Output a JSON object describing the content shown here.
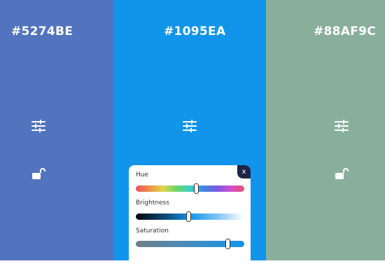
{
  "palette": {
    "columns": [
      {
        "hex": "#5274BE",
        "color": "#5274be"
      },
      {
        "hex": "#1095EA",
        "color": "#1095ea"
      },
      {
        "hex": "#88AF9C",
        "color": "#88af9c"
      }
    ]
  },
  "icons": {
    "adjust": "sliders-icon",
    "lock": "unlocked-padlock-icon"
  },
  "panel": {
    "close_label": "x",
    "sliders": [
      {
        "label": "Hue",
        "value": 0.56
      },
      {
        "label": "Brightness",
        "value": 0.49
      },
      {
        "label": "Saturation",
        "value": 0.85
      }
    ]
  }
}
